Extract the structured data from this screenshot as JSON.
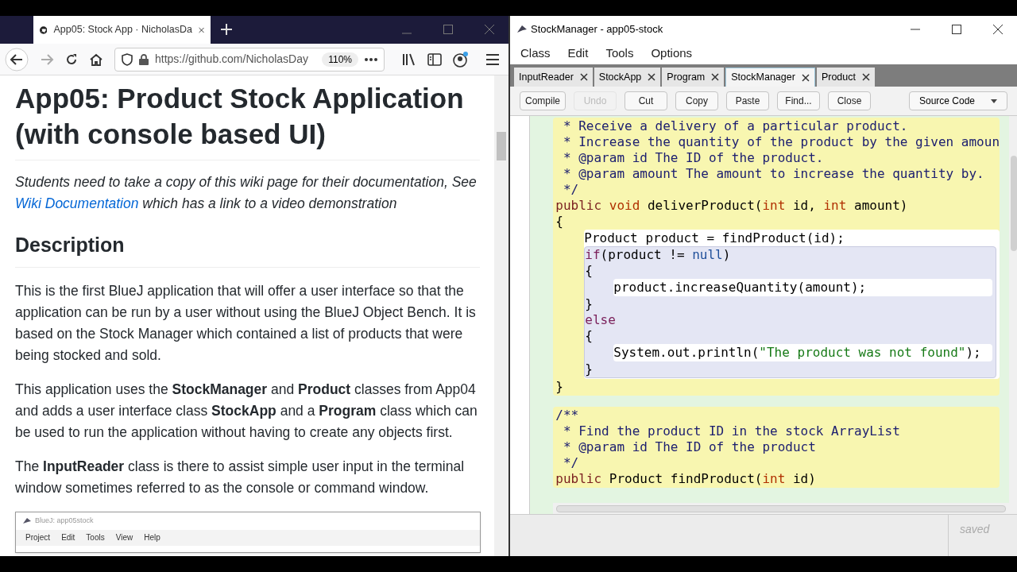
{
  "browser": {
    "tab": {
      "title": "App05: Stock App · NicholasDa",
      "selected": true
    },
    "url": "https://github.com/NicholasDay",
    "zoom": "110%"
  },
  "page": {
    "heading": "App05: Product Stock Application (with console based UI)",
    "intro": {
      "before": "Students need to take a copy of this wiki page for their documentation, See ",
      "link": "Wiki Documentation",
      "after": " which has a link to a video demonstration"
    },
    "section_heading": "Description",
    "paragraphs": [
      "This is the first BlueJ application that will offer a user interface so that the application can be run by a user without using the BlueJ Object Bench. It is based on the Stock Manager which contained a list of products that were being stocked and sold.",
      "This application uses the **StockManager** and **Product** classes from App04 and adds a user interface class **StockApp** and a **Program** class which can be used to run the application without having to create any objects first.",
      "The **InputReader** class is there to assist simple user input in the terminal window sometimes referred to as the console or command window."
    ],
    "embedded_screenshot": {
      "title": "BlueJ: app05stock",
      "menu": [
        "Project",
        "Edit",
        "Tools",
        "View",
        "Help"
      ]
    }
  },
  "editor": {
    "title": "StockManager - app05-stock",
    "menu": [
      "Class",
      "Edit",
      "Tools",
      "Options"
    ],
    "tabs": [
      {
        "label": "InputReader",
        "selected": false
      },
      {
        "label": "StockApp",
        "selected": false
      },
      {
        "label": "Program",
        "selected": false
      },
      {
        "label": "StockManager",
        "selected": true
      },
      {
        "label": "Product",
        "selected": false
      }
    ],
    "toolbar": [
      {
        "label": "Compile",
        "disabled": false
      },
      {
        "label": "Undo",
        "disabled": true
      },
      {
        "label": "Cut",
        "disabled": false
      },
      {
        "label": "Copy",
        "disabled": false
      },
      {
        "label": "Paste",
        "disabled": false
      },
      {
        "label": "Find...",
        "disabled": false
      },
      {
        "label": "Close",
        "disabled": false
      }
    ],
    "view_selector": "Source Code",
    "code": [
      {
        "kind": "method",
        "items": [
          {
            "tokens": [
              {
                "kind": "comment",
                "text": " * Receive a delivery of a particular product."
              }
            ]
          },
          {
            "tokens": [
              {
                "kind": "comment",
                "text": " * Increase the quantity of the product by the given amoun"
              }
            ]
          },
          {
            "tokens": [
              {
                "kind": "comment",
                "text": " * @param id The ID of the product."
              }
            ]
          },
          {
            "tokens": [
              {
                "kind": "comment",
                "text": " * @param amount The amount to increase the quantity by."
              }
            ]
          },
          {
            "tokens": [
              {
                "kind": "comment",
                "text": " */"
              }
            ]
          },
          {
            "tokens": [
              {
                "kind": "modifier",
                "text": "public "
              },
              {
                "kind": "type",
                "text": "void"
              },
              {
                "kind": "plain",
                "text": " deliverProduct("
              },
              {
                "kind": "type",
                "text": "int"
              },
              {
                "kind": "plain",
                "text": " id, "
              },
              {
                "kind": "type",
                "text": "int"
              },
              {
                "kind": "plain",
                "text": " amount)"
              }
            ]
          },
          {
            "tokens": [
              {
                "kind": "plain",
                "text": "{"
              }
            ]
          },
          {
            "kind": "body",
            "items": [
              {
                "tokens": [
                  {
                    "kind": "plain",
                    "text": "Product product = findProduct(id);"
                  }
                ]
              },
              {
                "kind": "branch",
                "items": [
                  {
                    "tokens": [
                      {
                        "kind": "control",
                        "text": "if"
                      },
                      {
                        "kind": "plain",
                        "text": "(product != "
                      },
                      {
                        "kind": "literal",
                        "text": "null"
                      },
                      {
                        "kind": "plain",
                        "text": ")"
                      }
                    ]
                  },
                  {
                    "tokens": [
                      {
                        "kind": "plain",
                        "text": "{"
                      }
                    ]
                  },
                  {
                    "kind": "body",
                    "items": [
                      {
                        "tokens": [
                          {
                            "kind": "plain",
                            "text": "product.increaseQuantity(amount);"
                          }
                        ]
                      }
                    ]
                  },
                  {
                    "tokens": [
                      {
                        "kind": "plain",
                        "text": "}"
                      }
                    ]
                  },
                  {
                    "tokens": [
                      {
                        "kind": "control",
                        "text": "else"
                      }
                    ]
                  },
                  {
                    "tokens": [
                      {
                        "kind": "plain",
                        "text": "{"
                      }
                    ]
                  },
                  {
                    "kind": "body",
                    "items": [
                      {
                        "tokens": [
                          {
                            "kind": "plain",
                            "text": "System.out.println("
                          },
                          {
                            "kind": "string",
                            "text": "\"The product was not found\""
                          },
                          {
                            "kind": "plain",
                            "text": ");"
                          }
                        ]
                      }
                    ]
                  },
                  {
                    "tokens": [
                      {
                        "kind": "plain",
                        "text": "}"
                      }
                    ]
                  }
                ]
              }
            ]
          },
          {
            "tokens": [
              {
                "kind": "plain",
                "text": "}"
              }
            ]
          }
        ]
      },
      {
        "kind": "method",
        "items": [
          {
            "tokens": [
              {
                "kind": "comment",
                "text": "/**"
              }
            ]
          },
          {
            "tokens": [
              {
                "kind": "comment",
                "text": " * Find the product ID in the stock ArrayList"
              }
            ]
          },
          {
            "tokens": [
              {
                "kind": "comment",
                "text": " * @param id The ID of the product"
              }
            ]
          },
          {
            "tokens": [
              {
                "kind": "comment",
                "text": " */"
              }
            ]
          },
          {
            "tokens": [
              {
                "kind": "modifier",
                "text": "public"
              },
              {
                "kind": "plain",
                "text": " Product findProduct("
              },
              {
                "kind": "type",
                "text": "int"
              },
              {
                "kind": "plain",
                "text": " id)"
              }
            ]
          }
        ]
      }
    ],
    "status": "saved"
  }
}
